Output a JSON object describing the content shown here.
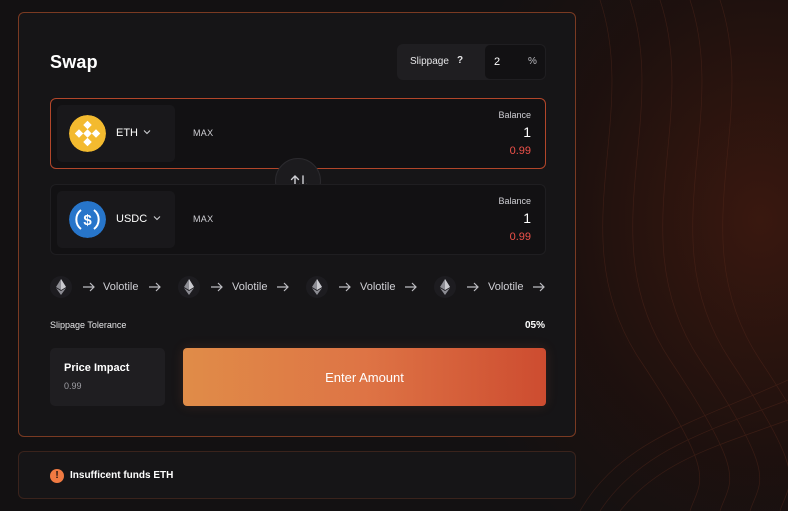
{
  "swap": {
    "title": "Swap",
    "slippage": {
      "label": "Slippage",
      "help": "?",
      "value": "2",
      "unit": "%"
    },
    "from": {
      "token": "ETH",
      "token_icon": "bnb-icon",
      "max_label": "MAX",
      "balance_label": "Balance",
      "amount": "1",
      "sub_value": "0.99"
    },
    "to": {
      "token": "USDC",
      "token_icon": "usdc-icon",
      "max_label": "MAX",
      "balance_label": "Balance",
      "amount": "1",
      "sub_value": "0.99"
    },
    "route": [
      {
        "icon": "eth-icon",
        "label": "Volotile"
      },
      {
        "icon": "eth-icon",
        "label": "Volotile"
      },
      {
        "icon": "eth-icon",
        "label": "Volotile"
      },
      {
        "icon": "eth-icon",
        "label": "Volotile"
      }
    ],
    "slippage_tolerance": {
      "label": "Slippage Tolerance",
      "value": "05%"
    },
    "price_impact": {
      "label": "Price Impact",
      "value": "0.99"
    },
    "action_label": "Enter Amount"
  },
  "alert": {
    "icon": "exclamation-icon",
    "symbol": "!",
    "text": "Insufficent funds ETH"
  },
  "colors": {
    "accent_orange": "#de7445",
    "accent_red": "#cd4c30",
    "negative": "#f0524a",
    "bnb_yellow": "#f3ba2f",
    "usdc_blue": "#2775ca"
  }
}
